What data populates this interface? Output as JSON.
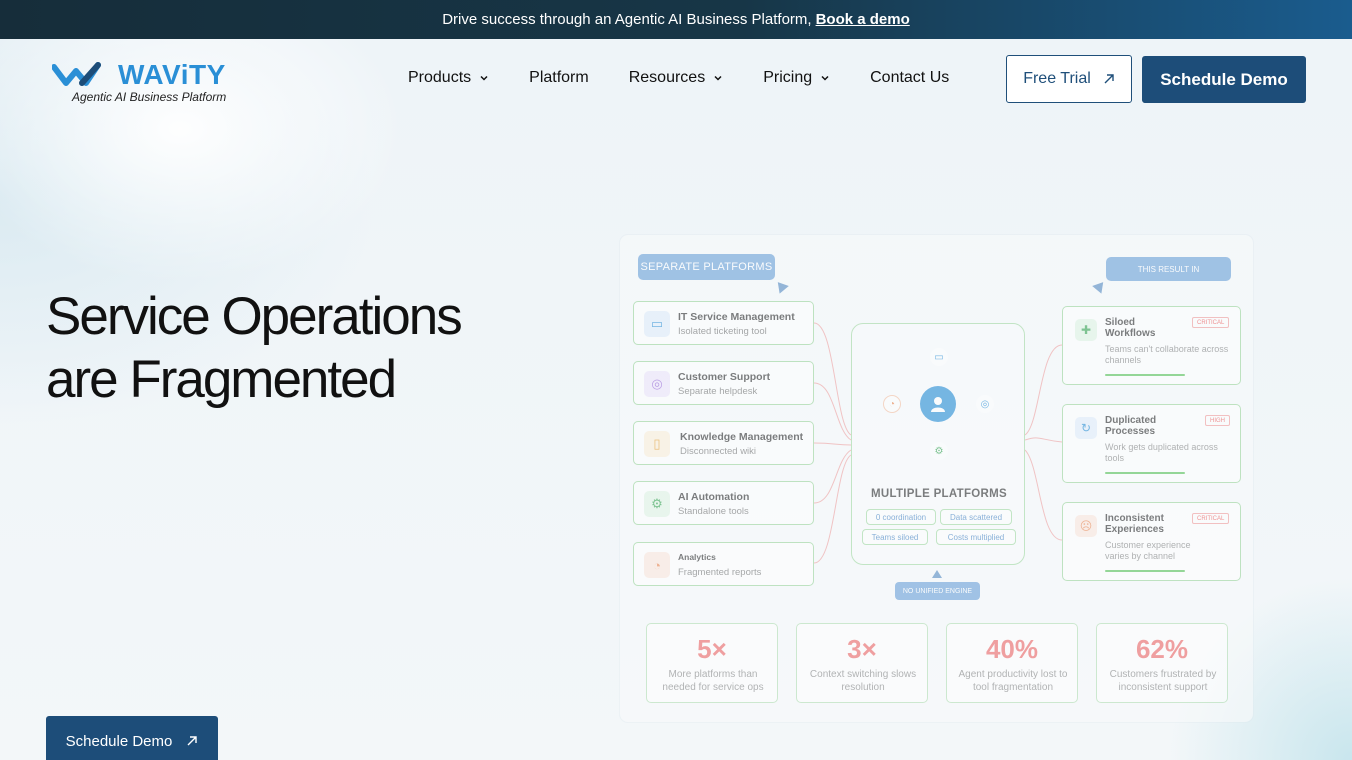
{
  "announcement": {
    "text": "Drive success through an Agentic AI Business Platform,",
    "link": "Book a demo"
  },
  "header": {
    "logo_word": "WAViTY",
    "logo_tagline": "Agentic AI Business Platform",
    "nav": [
      {
        "label": "Products",
        "has_dropdown": true
      },
      {
        "label": "Platform",
        "has_dropdown": false
      },
      {
        "label": "Resources",
        "has_dropdown": true
      },
      {
        "label": "Pricing",
        "has_dropdown": true
      },
      {
        "label": "Contact Us",
        "has_dropdown": false
      }
    ],
    "free_trial": "Free Trial",
    "schedule_demo": "Schedule Demo"
  },
  "hero": {
    "title_line1": "Service Operations",
    "title_line2": "are Fragmented",
    "cta": "Schedule Demo"
  },
  "diagram": {
    "separate_label": "SEPARATE PLATFORMS",
    "result_label": "THIS RESULT IN",
    "sources": [
      {
        "title": "IT Service Management",
        "subtitle": "Isolated ticketing tool",
        "icon": "monitor-icon",
        "color": "#e3eefb"
      },
      {
        "title": "Customer Support",
        "subtitle": "Separate helpdesk",
        "icon": "headset-icon",
        "color": "#efe6fb"
      },
      {
        "title": "Knowledge Management",
        "subtitle": "Disconnected wiki",
        "icon": "book-icon",
        "color": "#fdf0dc"
      },
      {
        "title": "AI Automation",
        "subtitle": "Standalone tools",
        "icon": "gear-icon",
        "color": "#e3f5e6"
      },
      {
        "title": "Analytics",
        "subtitle": "Fragmented reports",
        "icon": "chart-icon",
        "color": "#fde9df"
      }
    ],
    "center": {
      "title": "MULTIPLE PLATFORMS",
      "chips": [
        "0 coordination",
        "Data scattered",
        "Teams siloed",
        "Costs multiplied"
      ]
    },
    "no_engine": "NO UNIFIED ENGINE",
    "results": [
      {
        "title": "Siloed Workflows",
        "desc": "Teams can't collaborate across channels",
        "badge": "CRITICAL",
        "icon": "puzzle-icon"
      },
      {
        "title": "Duplicated Processes",
        "desc": "Work gets duplicated across tools",
        "badge": "HIGH",
        "icon": "refresh-icon"
      },
      {
        "title": "Inconsistent Experiences",
        "desc": "Customer experience varies by channel",
        "badge": "CRITICAL",
        "icon": "frown-icon"
      }
    ],
    "stats": [
      {
        "value": "5×",
        "label": "More platforms than needed for service ops"
      },
      {
        "value": "3×",
        "label": "Context switching slows resolution"
      },
      {
        "value": "40%",
        "label": "Agent productivity lost to tool fragmentation"
      },
      {
        "value": "62%",
        "label": "Customers frustrated by inconsistent support"
      }
    ]
  },
  "colors": {
    "brand_blue": "#2a8fd6",
    "button_navy": "#1d4d79",
    "stat_red": "#ee6a6a",
    "border_green": "#9fd79f"
  }
}
